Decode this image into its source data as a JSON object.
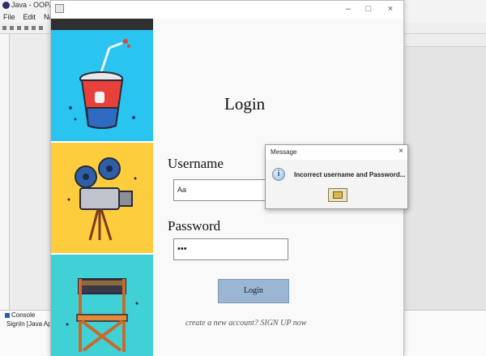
{
  "ide": {
    "title": "Java - OOP/src",
    "menu": [
      "File",
      "Edit",
      "Navi"
    ],
    "console_tab": "Console",
    "console_text": "SignIn [Java App"
  },
  "login_window": {
    "heading": "Login",
    "username_label": "Username",
    "username_value": "Aa",
    "password_label": "Password",
    "password_value": "•••",
    "login_button": "Login",
    "signup_link": "create a new account? SIGN UP now",
    "minimize": "–",
    "maximize": "□",
    "close": "×"
  },
  "dialog": {
    "title": "Message",
    "close": "×",
    "message": "Incorrect username and Password...",
    "icon_glyph": "i"
  },
  "colors": {
    "panel_top": "#29c4ef",
    "panel_mid": "#fecd3d",
    "panel_bottom": "#3fd1d6",
    "login_button": "#9ab6d2"
  }
}
